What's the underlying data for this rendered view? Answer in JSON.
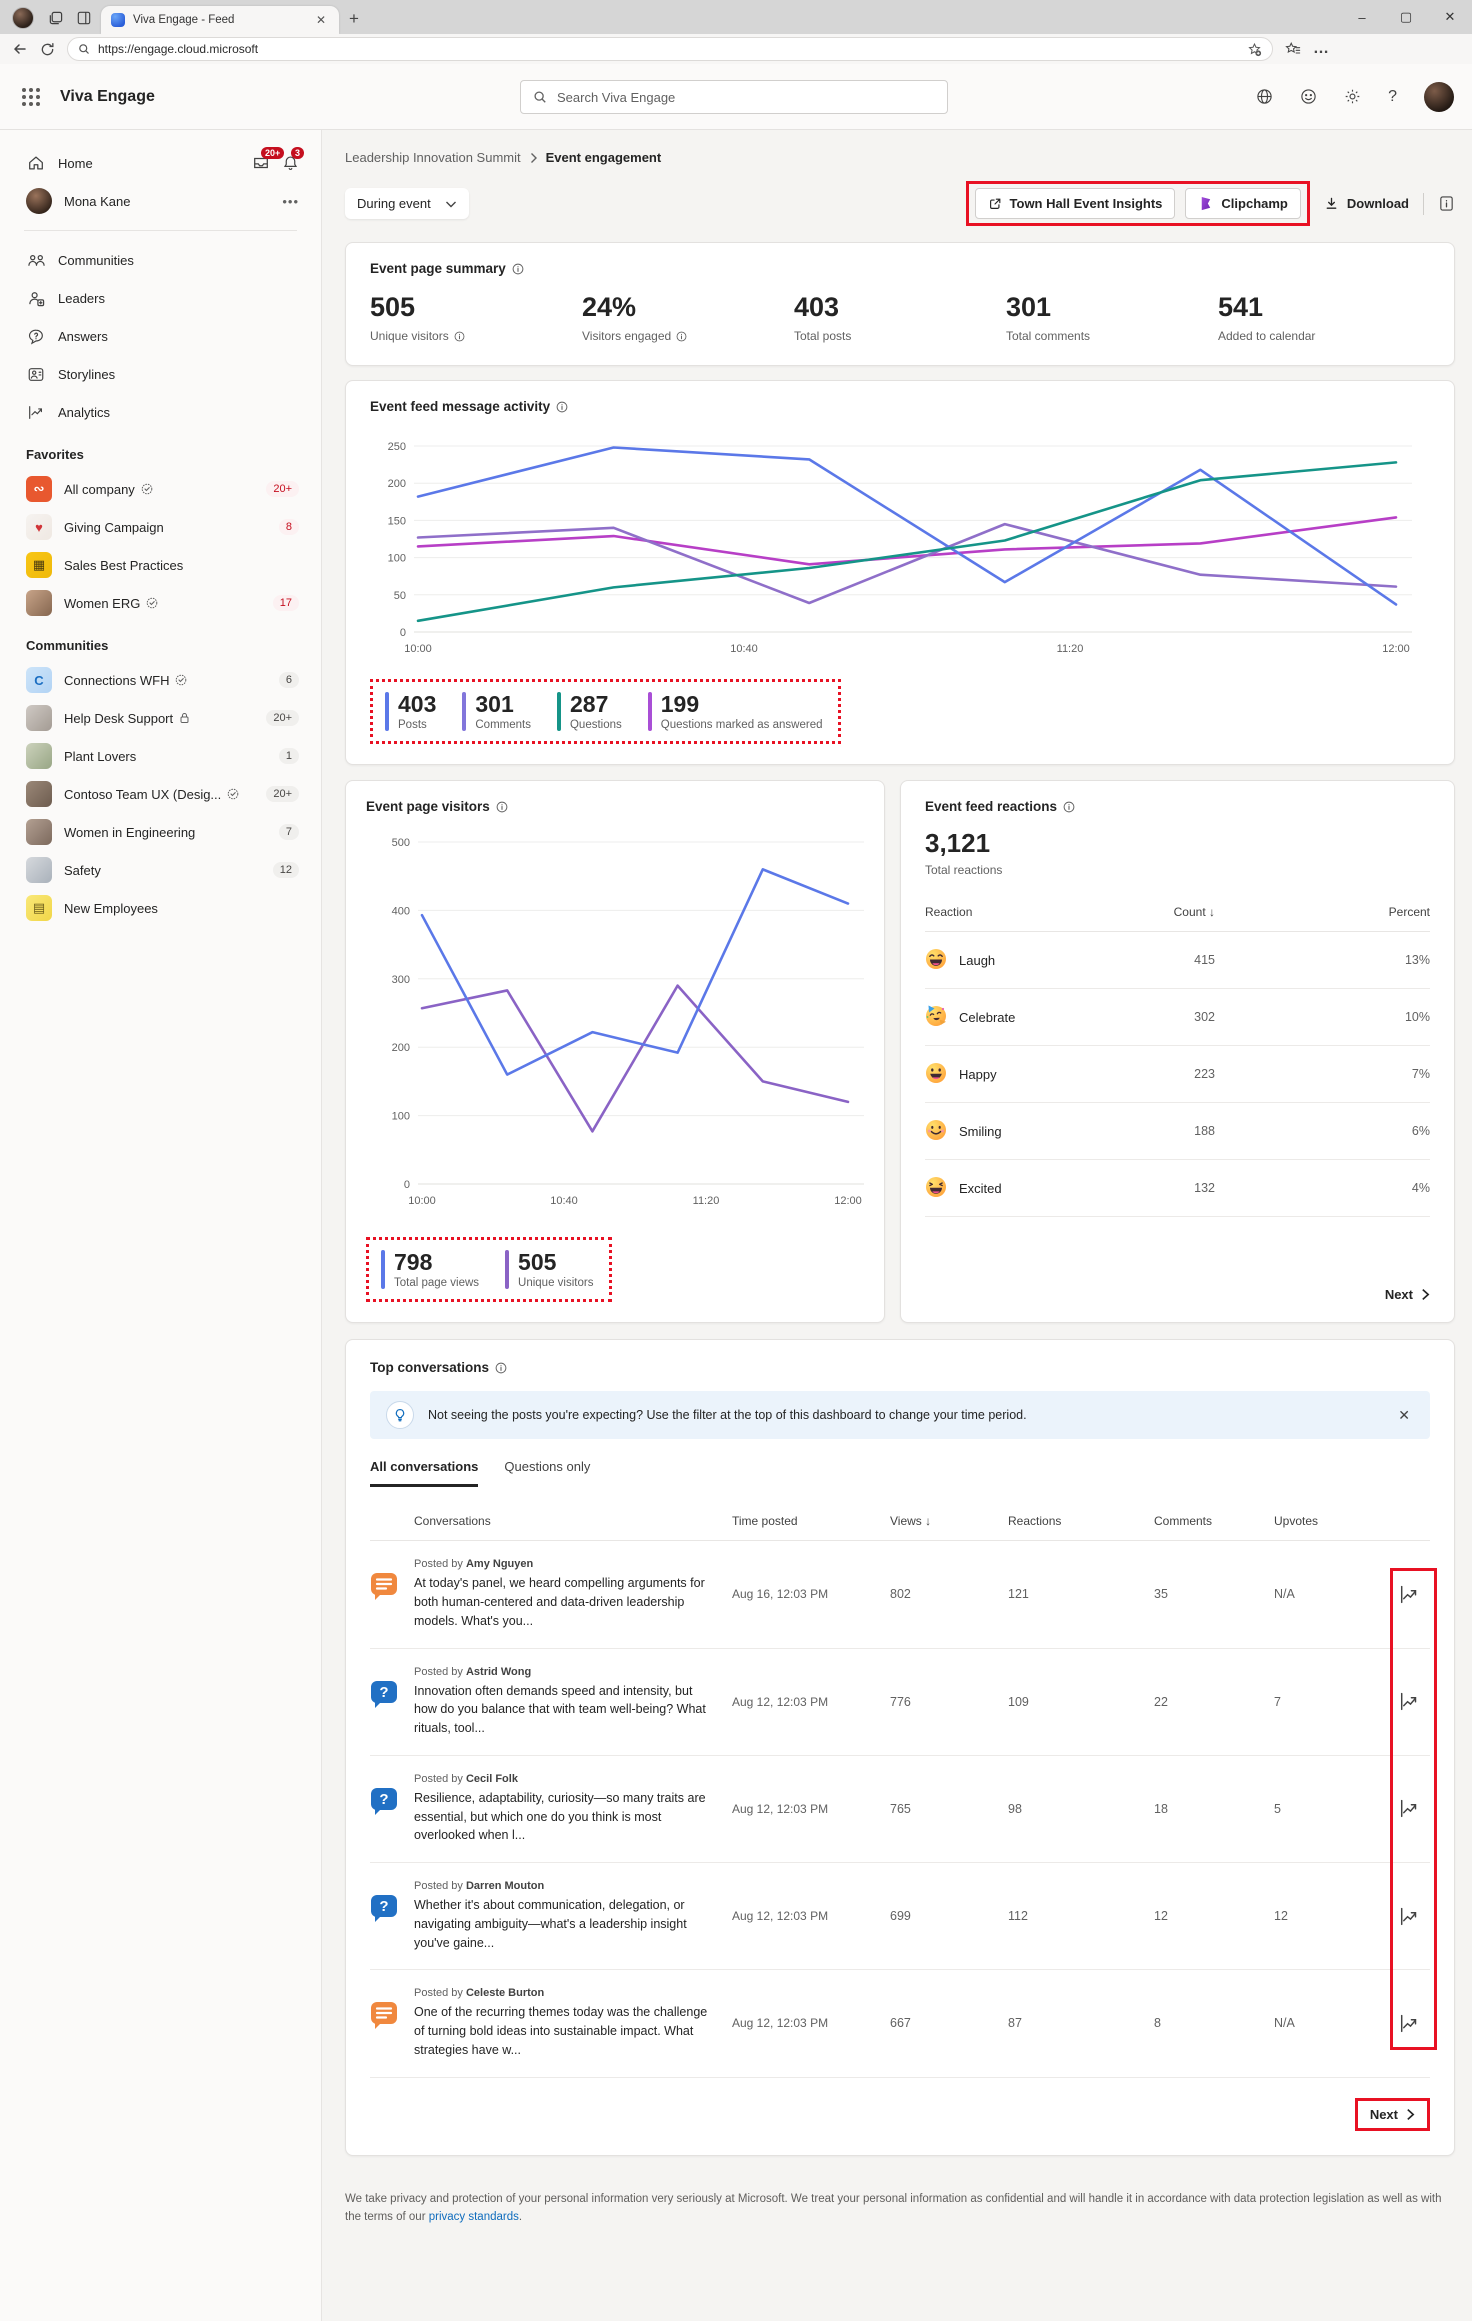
{
  "browser": {
    "tab_title": "Viva Engage - Feed",
    "url": "https://engage.cloud.microsoft"
  },
  "app_header": {
    "title": "Viva Engage",
    "search_placeholder": "Search Viva Engage"
  },
  "sidebar": {
    "home": {
      "label": "Home",
      "inbox_badge": "20+",
      "bell_badge": "3"
    },
    "user": {
      "name": "Mona Kane"
    },
    "nav": [
      {
        "label": "Communities",
        "icon": "communities-icon"
      },
      {
        "label": "Leaders",
        "icon": "leaders-icon"
      },
      {
        "label": "Answers",
        "icon": "answers-icon"
      },
      {
        "label": "Storylines",
        "icon": "storylines-icon"
      },
      {
        "label": "Analytics",
        "icon": "analytics-icon"
      }
    ],
    "favorites_title": "Favorites",
    "favorites": [
      {
        "label": "All company",
        "badge": "20+",
        "verified": true,
        "icon": {
          "bg": "#e8582f",
          "bg2": "#e8582f",
          "glyph": "∾",
          "fg": "#ffffff"
        }
      },
      {
        "label": "Giving Campaign",
        "badge": "8",
        "icon": {
          "bg": "#f6f3f0",
          "bg2": "#efe8e2",
          "glyph": "♥",
          "fg": "#d13438"
        }
      },
      {
        "label": "Sales Best Practices",
        "icon": {
          "bg": "#f8c616",
          "bg2": "#efb90a",
          "glyph": "▦",
          "fg": "#4a3b10"
        }
      },
      {
        "label": "Women ERG",
        "badge": "17",
        "verified": true,
        "icon": {
          "bg": "#c8a489",
          "bg2": "#85664f"
        }
      }
    ],
    "communities_title": "Communities",
    "communities": [
      {
        "label": "Connections WFH",
        "badge": "6",
        "verified": true,
        "icon": {
          "bg": "#cde4f9",
          "bg2": "#b2d3f4",
          "glyph": "C",
          "fg": "#1b6ec2"
        }
      },
      {
        "label": "Help Desk Support",
        "badge": "20+",
        "locked": true,
        "icon": {
          "bg": "#cfc9c4",
          "bg2": "#a39b93"
        }
      },
      {
        "label": "Plant Lovers",
        "badge": "1",
        "icon": {
          "bg": "#ccd2bc",
          "bg2": "#98a685"
        }
      },
      {
        "label": "Contoso Team UX (Desig...",
        "badge": "20+",
        "verified": true,
        "icon": {
          "bg": "#9b8878",
          "bg2": "#6d5c4f"
        }
      },
      {
        "label": "Women in Engineering",
        "badge": "7",
        "icon": {
          "bg": "#b3a092",
          "bg2": "#7c695d"
        }
      },
      {
        "label": "Safety",
        "badge": "12",
        "icon": {
          "bg": "#d6d9dd",
          "bg2": "#a9b1ba"
        }
      },
      {
        "label": "New Employees",
        "icon": {
          "bg": "#f9e878",
          "bg2": "#f1d648",
          "glyph": "▤",
          "fg": "#6b5d1a"
        }
      }
    ]
  },
  "page": {
    "breadcrumb": {
      "parent": "Leadership Innovation Summit",
      "current": "Event engagement"
    },
    "filter_label": "During event",
    "actions": {
      "town_hall": "Town Hall Event Insights",
      "clipchamp": "Clipchamp",
      "download": "Download"
    }
  },
  "summary": {
    "title": "Event page summary",
    "stats": [
      {
        "value": "505",
        "label": "Unique visitors",
        "info": true
      },
      {
        "value": "24%",
        "label": "Visitors engaged",
        "info": true
      },
      {
        "value": "403",
        "label": "Total posts",
        "info": false
      },
      {
        "value": "301",
        "label": "Total comments",
        "info": false
      },
      {
        "value": "541",
        "label": "Added to calendar",
        "info": false
      }
    ]
  },
  "activity": {
    "title": "Event feed message activity",
    "stats": [
      {
        "value": "403",
        "label": "Posts",
        "color": "#5b78e8"
      },
      {
        "value": "301",
        "label": "Comments",
        "color": "#8276db"
      },
      {
        "value": "287",
        "label": "Questions",
        "color": "#159488"
      },
      {
        "value": "199",
        "label": "Questions marked as answered",
        "color": "#a94fd6"
      }
    ]
  },
  "visitors": {
    "title": "Event page visitors",
    "stats": [
      {
        "value": "798",
        "label": "Total page views",
        "color": "#5b78e8"
      },
      {
        "value": "505",
        "label": "Unique visitors",
        "color": "#8a63c5"
      }
    ]
  },
  "reactions": {
    "title": "Event feed reactions",
    "total_value": "3,121",
    "total_label": "Total reactions",
    "columns": [
      "Reaction",
      "Count",
      "Percent"
    ],
    "sorted_column": "Count",
    "rows": [
      {
        "icon": "laugh-emoji",
        "label": "Laugh",
        "count": "415",
        "percent": "13%"
      },
      {
        "icon": "celebrate-emoji",
        "label": "Celebrate",
        "count": "302",
        "percent": "10%"
      },
      {
        "icon": "happy-emoji",
        "label": "Happy",
        "count": "223",
        "percent": "7%"
      },
      {
        "icon": "smiling-emoji",
        "label": "Smiling",
        "count": "188",
        "percent": "6%"
      },
      {
        "icon": "excited-emoji",
        "label": "Excited",
        "count": "132",
        "percent": "4%"
      }
    ],
    "next_label": "Next"
  },
  "conversations": {
    "title": "Top conversations",
    "banner": "Not seeing the posts you're expecting? Use the filter at the top of this dashboard to change your time period.",
    "tabs": [
      "All conversations",
      "Questions only"
    ],
    "active_tab": 0,
    "columns": [
      "Conversations",
      "Time posted",
      "Views",
      "Reactions",
      "Comments",
      "Upvotes"
    ],
    "sorted_column": "Views",
    "rows": [
      {
        "type": "discussion",
        "posted_by_prefix": "Posted by",
        "author": "Amy Nguyen",
        "text": "At today's panel, we heard compelling arguments for both human-centered and data-driven leadership models. What's you...",
        "time": "Aug 16, 12:03 PM",
        "views": "802",
        "reactions": "121",
        "comments": "35",
        "upvotes": "N/A"
      },
      {
        "type": "question",
        "posted_by_prefix": "Posted by",
        "author": "Astrid Wong",
        "text": "Innovation often demands speed and intensity, but how do you balance that with team well-being? What rituals, tool...",
        "time": "Aug 12, 12:03 PM",
        "views": "776",
        "reactions": "109",
        "comments": "22",
        "upvotes": "7"
      },
      {
        "type": "question",
        "posted_by_prefix": "Posted by",
        "author": "Cecil Folk",
        "text": "Resilience, adaptability, curiosity—so many traits are essential, but which one do you think is most overlooked when l...",
        "time": "Aug 12, 12:03 PM",
        "views": "765",
        "reactions": "98",
        "comments": "18",
        "upvotes": "5"
      },
      {
        "type": "question",
        "posted_by_prefix": "Posted by",
        "author": "Darren Mouton",
        "text": "Whether it's about communication, delegation, or navigating ambiguity—what's a leadership insight you've gaine...",
        "time": "Aug 12, 12:03 PM",
        "views": "699",
        "reactions": "112",
        "comments": "12",
        "upvotes": "12"
      },
      {
        "type": "discussion",
        "posted_by_prefix": "Posted by",
        "author": "Celeste Burton",
        "text": "One of the recurring themes today was the challenge of turning bold ideas into sustainable impact. What strategies have w...",
        "time": "Aug 12, 12:03 PM",
        "views": "667",
        "reactions": "87",
        "comments": "8",
        "upvotes": "N/A"
      }
    ],
    "next_label": "Next"
  },
  "footer": {
    "text_before": "We take privacy and protection of your personal information very seriously at Microsoft. We treat your personal information as confidential and will handle it in accordance with data protection legislation as well as with the terms of our ",
    "link": "privacy standards",
    "text_after": "."
  },
  "chart_data": [
    {
      "type": "line",
      "title": "Event feed message activity",
      "x": [
        "10:00",
        "10:24",
        "10:48",
        "11:12",
        "11:36",
        "12:00"
      ],
      "xticklabels": [
        "10:00",
        "10:40",
        "11:20",
        "12:00"
      ],
      "ylim": [
        0,
        250
      ],
      "yticks": [
        0,
        50,
        100,
        150,
        200,
        250
      ],
      "grid": "horizontal",
      "legend": "none",
      "series": [
        {
          "name": "Questions marked as answered",
          "color": "#b73fc6",
          "values": [
            115,
            129,
            91,
            111,
            119,
            154
          ]
        },
        {
          "name": "Comments",
          "color": "#8f6fc9",
          "values": [
            127,
            140,
            39,
            145,
            77,
            61
          ]
        },
        {
          "name": "Posts",
          "color": "#5b78e8",
          "values": [
            182,
            248,
            232,
            67,
            218,
            37
          ]
        },
        {
          "name": "Questions",
          "color": "#159488",
          "values": [
            15,
            60,
            86,
            123,
            204,
            228
          ]
        }
      ]
    },
    {
      "type": "line",
      "title": "Event page visitors",
      "x": [
        "10:00",
        "10:24",
        "10:48",
        "11:12",
        "11:36",
        "12:00"
      ],
      "xticklabels": [
        "10:00",
        "10:40",
        "11:20",
        "12:00"
      ],
      "ylim": [
        0,
        500
      ],
      "yticks": [
        0,
        100,
        200,
        300,
        400,
        500
      ],
      "grid": "horizontal",
      "legend": "none",
      "series": [
        {
          "name": "Unique visitors",
          "color": "#8a63c5",
          "values": [
            257,
            283,
            77,
            290,
            150,
            120
          ]
        },
        {
          "name": "Total page views",
          "color": "#5b78e8",
          "values": [
            393,
            160,
            222,
            192,
            460,
            410
          ]
        }
      ]
    }
  ]
}
